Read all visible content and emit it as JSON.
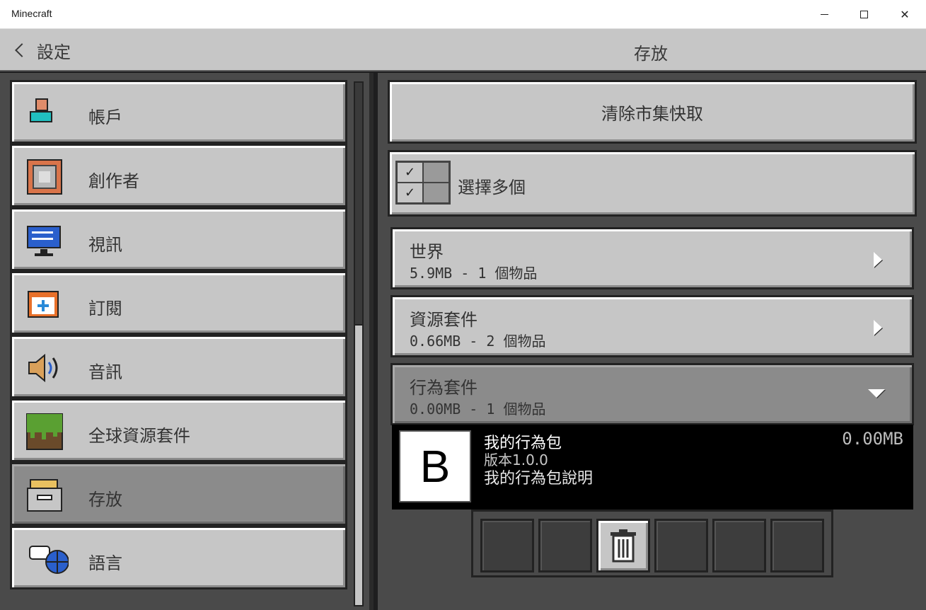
{
  "window": {
    "title": "Minecraft",
    "minimize_glyph": "",
    "maximize_glyph": "",
    "close_glyph": "✕"
  },
  "header": {
    "back_label": "設定",
    "title": "存放"
  },
  "sidebar": {
    "items": [
      {
        "label": "帳戶",
        "icon": "account-icon"
      },
      {
        "label": "創作者",
        "icon": "creator-icon"
      },
      {
        "label": "視訊",
        "icon": "video-icon"
      },
      {
        "label": "訂閱",
        "icon": "subscription-icon"
      },
      {
        "label": "音訊",
        "icon": "audio-icon"
      },
      {
        "label": "全球資源套件",
        "icon": "global-resource-pack-icon"
      },
      {
        "label": "存放",
        "icon": "storage-icon",
        "selected": true
      },
      {
        "label": "語言",
        "icon": "language-icon"
      }
    ]
  },
  "main": {
    "clear_cache_label": "清除市集快取",
    "select_multiple_label": "選擇多個",
    "checkmark": "✓",
    "categories": [
      {
        "name": "世界",
        "meta": "5.9MB - 1 個物品",
        "expanded": false
      },
      {
        "name": "資源套件",
        "meta": "0.66MB - 2 個物品",
        "expanded": false
      },
      {
        "name": "行為套件",
        "meta": "0.00MB - 1 個物品",
        "expanded": true
      }
    ],
    "pack": {
      "thumb_letter": "B",
      "name": "我的行為包",
      "version": "版本1.0.0",
      "description": "我的行為包說明",
      "size": "0.00MB"
    }
  },
  "colors": {
    "panel_bg": "#4a4a4a",
    "button_bg": "#c6c6c6",
    "selected_bg": "#8b8b8b"
  }
}
